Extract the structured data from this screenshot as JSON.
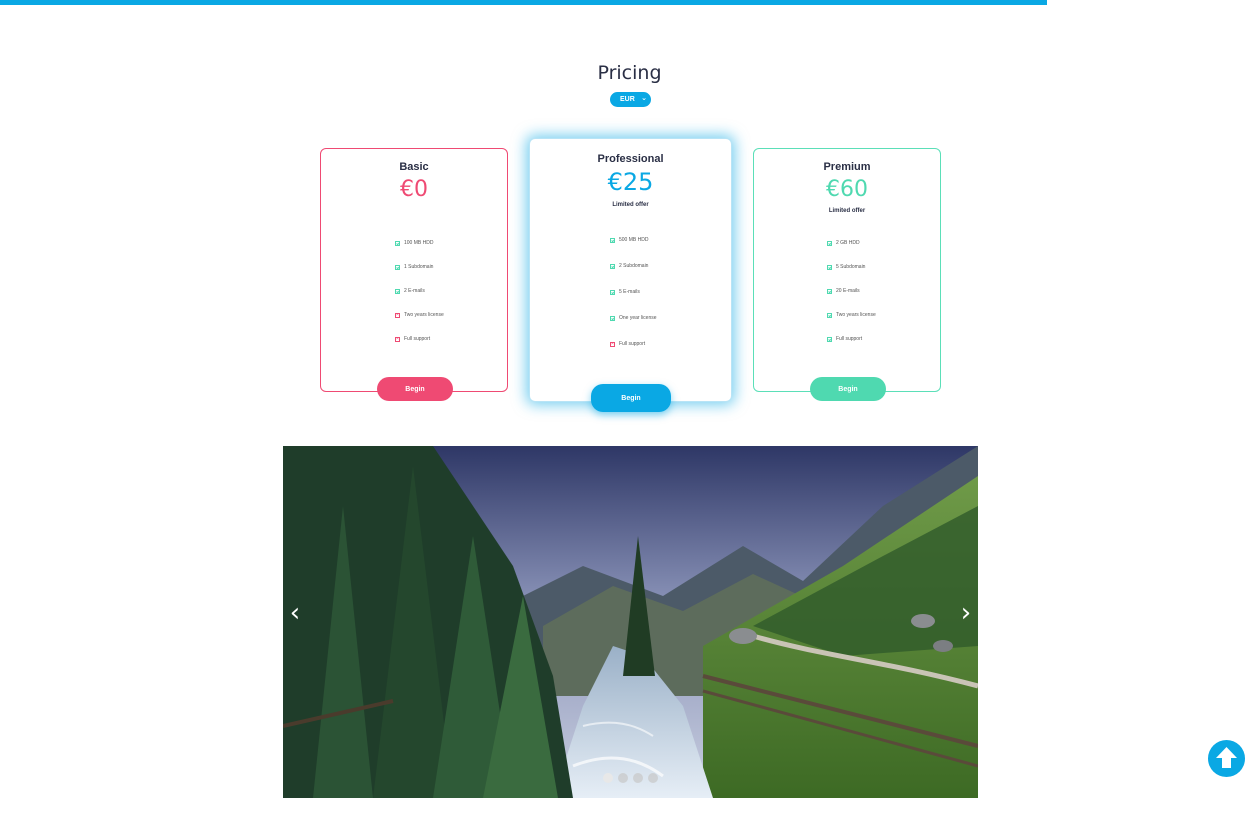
{
  "header": {
    "title": "Pricing"
  },
  "currency": {
    "selected": "EUR",
    "chevron": "⌄"
  },
  "plans": [
    {
      "name": "Basic",
      "price": "€0",
      "offer": "",
      "features": [
        {
          "label": "100 MB HDD",
          "included": true
        },
        {
          "label": "1 Subdomain",
          "included": true
        },
        {
          "label": "2 E-mails",
          "included": true
        },
        {
          "label": "Two years license",
          "included": false
        },
        {
          "label": "Full support",
          "included": false
        }
      ],
      "button": "Begin",
      "color": "#ef4a73"
    },
    {
      "name": "Professional",
      "price": "€25",
      "offer": "Limited offer",
      "features": [
        {
          "label": "500 MB HDD",
          "included": true
        },
        {
          "label": "2 Subdomain",
          "included": true
        },
        {
          "label": "5 E-mails",
          "included": true
        },
        {
          "label": "One year license",
          "included": true
        },
        {
          "label": "Full support",
          "included": false
        }
      ],
      "button": "Begin",
      "color": "#0aa8e4"
    },
    {
      "name": "Premium",
      "price": "€60",
      "offer": "Limited offer",
      "features": [
        {
          "label": "2 GB HDD",
          "included": true
        },
        {
          "label": "5 Subdomain",
          "included": true
        },
        {
          "label": "20 E-mails",
          "included": true
        },
        {
          "label": "Two years license",
          "included": true
        },
        {
          "label": "Full support",
          "included": true
        }
      ],
      "button": "Begin",
      "color": "#4fd9b0"
    }
  ],
  "carousel": {
    "prev_icon": "‹",
    "next_icon": "›",
    "slide_count": 4,
    "active_slide": 1
  },
  "icons": {
    "feature_included": "check-icon",
    "feature_excluded": "cross-icon",
    "scroll_top": "arrow-up-icon"
  },
  "colors": {
    "accent": "#0aa8e4",
    "basic": "#ef4a73",
    "premium": "#4fd9b0"
  }
}
